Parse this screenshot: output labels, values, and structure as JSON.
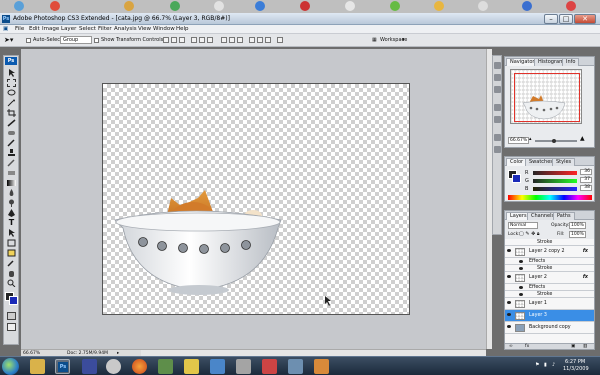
{
  "window": {
    "title": "Adobe Photoshop CS3 Extended - [cata.jpg @ 66.7% (Layer 3, RGB/8#)]",
    "app_badge": "Ps"
  },
  "menu": [
    "File",
    "Edit",
    "Image",
    "Layer",
    "Select",
    "Filter",
    "Analysis",
    "View",
    "Window",
    "Help"
  ],
  "options": {
    "auto_select_label": "Auto-Select:",
    "auto_select_value": "Group",
    "show_transform_label": "Show Transform Controls",
    "workspace_label": "Workspace"
  },
  "status": {
    "zoom": "66.67%",
    "doc": "Doc: 2.75M/9.94M"
  },
  "navigator": {
    "tabs": [
      "Navigator",
      "Histogram",
      "Info"
    ],
    "zoom": "66.67%"
  },
  "color_panel": {
    "tabs": [
      "Color",
      "Swatches",
      "Styles"
    ],
    "rows": [
      {
        "label": "R",
        "value": "36"
      },
      {
        "label": "G",
        "value": "37"
      },
      {
        "label": "B",
        "value": "38"
      }
    ]
  },
  "layers_panel": {
    "tabs": [
      "Layers",
      "Channels",
      "Paths"
    ],
    "blend_mode": "Normal",
    "opacity_label": "Opacity:",
    "opacity_value": "100%",
    "lock_label": "Lock:",
    "fill_label": "Fill:",
    "fill_value": "100%",
    "layers": [
      {
        "name": "Stroke",
        "kind": "effect"
      },
      {
        "name": "Layer 2 copy 2",
        "kind": "layer",
        "fx": "fx"
      },
      {
        "name": "Effects",
        "kind": "effect"
      },
      {
        "name": "Stroke",
        "kind": "effect"
      },
      {
        "name": "Layer 2",
        "kind": "layer",
        "fx": "fx"
      },
      {
        "name": "Effects",
        "kind": "effect"
      },
      {
        "name": "Stroke",
        "kind": "effect"
      },
      {
        "name": "Layer 1",
        "kind": "layer"
      },
      {
        "name": "Layer 3",
        "kind": "layer",
        "selected": true
      },
      {
        "name": "Background copy",
        "kind": "layer"
      }
    ]
  },
  "taskbar": {
    "time": "6:27 PM",
    "date": "11/3/2009"
  },
  "colors": {
    "selection": "#3a8ee6",
    "taskbar": "#1b2a3b",
    "bowl_dots": "#8e949c"
  }
}
